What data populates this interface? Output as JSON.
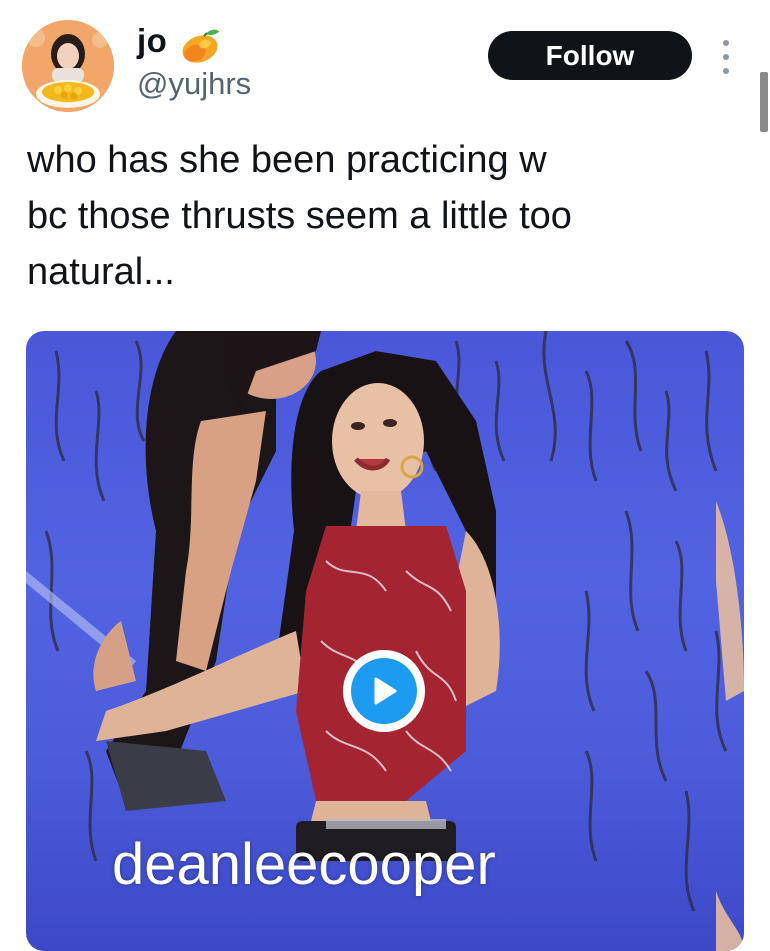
{
  "tweet": {
    "author": {
      "display_name": "jo",
      "emoji_icon": "mango-icon",
      "handle": "@yujhrs"
    },
    "follow_label": "Follow",
    "more_icon": "more-dots-icon",
    "text": "who has she been practicing w\nbc those thrusts seem a little too\nnatural...",
    "media": {
      "type": "video",
      "play_icon": "play-icon",
      "watermark": "deanleecooper"
    }
  },
  "colors": {
    "follow_bg": "#0f1419",
    "handle": "#536471",
    "play_blue": "#1d9bf0",
    "stage_blue": "#4a57d8"
  }
}
